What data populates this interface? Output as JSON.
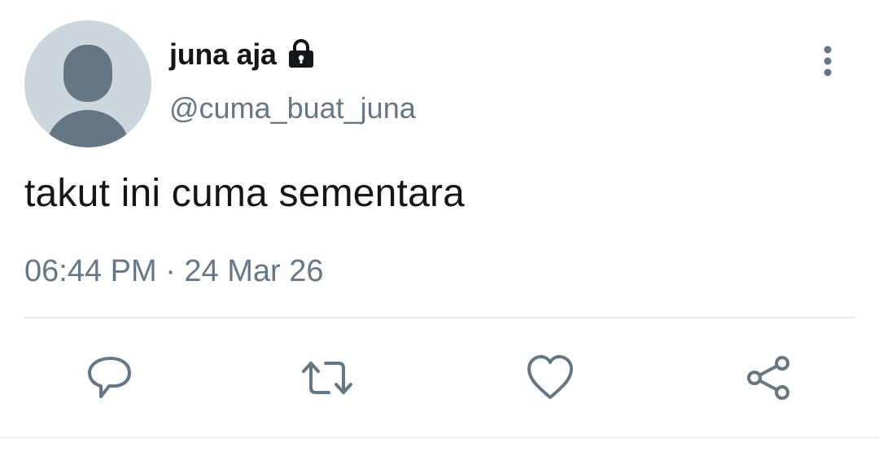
{
  "user": {
    "display_name": "juna aja",
    "handle": "@cuma_buat_juna",
    "protected_icon": "lock-icon",
    "avatar": "default-avatar"
  },
  "tweet": {
    "text": "takut ini cuma sementara",
    "timestamp": "06:44 PM · 24 Mar 26"
  },
  "actions": {
    "reply_icon": "reply-icon",
    "retweet_icon": "retweet-icon",
    "like_icon": "heart-icon",
    "share_icon": "share-icon",
    "more_icon": "more-vertical-icon"
  },
  "colors": {
    "text_primary": "#14171a",
    "text_secondary": "#657786",
    "icon": "#657786",
    "avatar_bg": "#ccd6dd",
    "avatar_fg": "#657786",
    "divider": "#e6ecf0"
  }
}
